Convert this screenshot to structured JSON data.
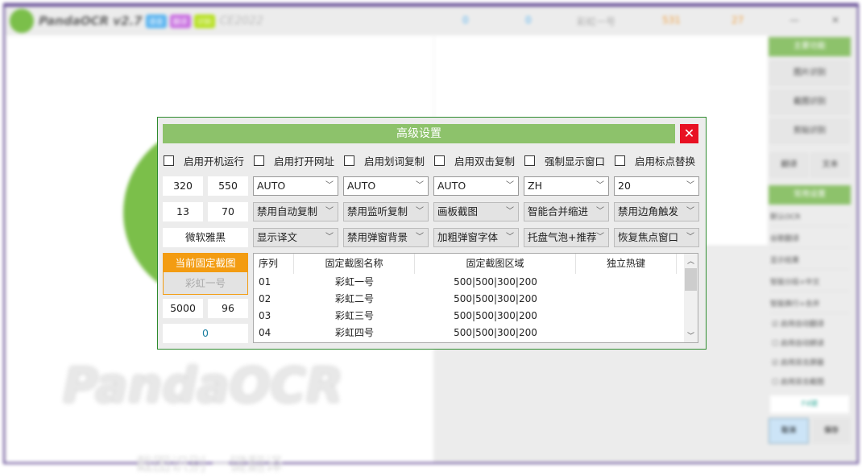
{
  "app": {
    "title": "PandaOCR v2.7",
    "badges": [
      {
        "text": "语音",
        "color": "#5ab4f0"
      },
      {
        "text": "翻译",
        "color": "#c86ee0"
      },
      {
        "text": "识别",
        "color": "#b6e01e"
      }
    ],
    "edition": "CE2022",
    "stats": [
      "0",
      "0",
      "彩虹一号",
      "531",
      "27"
    ],
    "minimize": "—",
    "close": "✕",
    "logo_text": "PandaOCR",
    "slogan": "截图识别 一键翻译"
  },
  "sidebar": {
    "header1": "主要功能",
    "buttons": [
      "图片识别",
      "截图识别",
      "剪贴识别"
    ],
    "small_buttons": [
      "翻译",
      "文本"
    ],
    "header2": "常用设置",
    "selects": [
      "默认OCR",
      "谷歌翻译",
      "显示结果",
      "智能分段+中文",
      "智能换行+合并"
    ],
    "checks": [
      {
        "label": "启用自动翻译",
        "checked": true
      },
      {
        "label": "启用自动朗读",
        "checked": false
      },
      {
        "label": "启用双击屏蔽",
        "checked": true
      },
      {
        "label": "启用双击截图",
        "checked": false
      }
    ],
    "hotkey": "F4键",
    "bottom": [
      "取消",
      "保存"
    ]
  },
  "dialog": {
    "title": "高级设置",
    "close": "✕",
    "checkboxes": [
      "启用开机运行",
      "启用打开网址",
      "启用划词复制",
      "启用双击复制",
      "强制显示窗口",
      "启用标点替换"
    ],
    "inputs_row1": [
      "320",
      "550"
    ],
    "inputs_row2": [
      "13",
      "70"
    ],
    "font": "微软雅黑",
    "selects_row1": [
      "AUTO",
      "AUTO",
      "AUTO",
      "ZH",
      "20"
    ],
    "selects_row2": [
      "禁用自动复制",
      "禁用监听复制",
      "画板截图",
      "智能合并缩进",
      "禁用边角触发"
    ],
    "selects_row3": [
      "显示译文",
      "禁用弹窗背景",
      "加粗弹窗字体",
      "托盘气泡+推荐",
      "恢复焦点窗口"
    ],
    "current_fixed": "当前固定截图",
    "current_fixed_value": "彩虹一号",
    "inputs_row5": [
      "5000",
      "96"
    ],
    "counter": "0",
    "table": {
      "headers": [
        "序列",
        "固定截图名称",
        "固定截图区域",
        "独立热键"
      ],
      "rows": [
        [
          "01",
          "彩虹一号",
          "500|500|300|200",
          ""
        ],
        [
          "02",
          "彩虹二号",
          "500|500|300|200",
          ""
        ],
        [
          "03",
          "彩虹三号",
          "500|500|300|200",
          ""
        ],
        [
          "04",
          "彩虹四号",
          "500|500|300|200",
          ""
        ]
      ]
    }
  }
}
